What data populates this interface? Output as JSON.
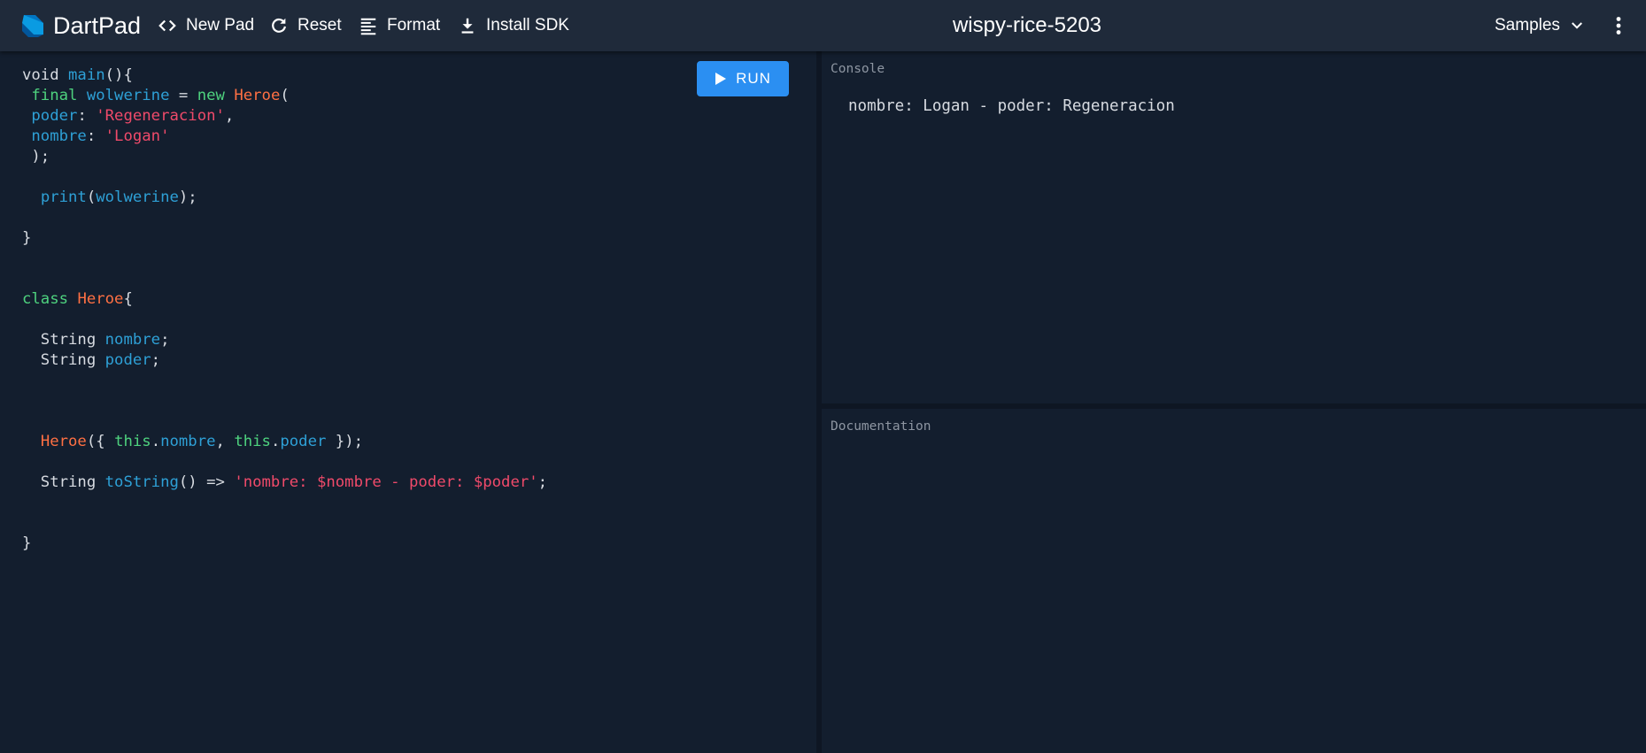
{
  "header": {
    "app_title": "DartPad",
    "toolbar": [
      {
        "id": "new-pad",
        "label": "New Pad",
        "icon": "code-brackets-icon"
      },
      {
        "id": "reset",
        "label": "Reset",
        "icon": "refresh-icon"
      },
      {
        "id": "format",
        "label": "Format",
        "icon": "format-lines-icon"
      },
      {
        "id": "install-sdk",
        "label": "Install SDK",
        "icon": "download-icon"
      }
    ],
    "pad_name": "wispy-rice-5203",
    "samples_label": "Samples",
    "more_icon": "more-vert-icon"
  },
  "editor": {
    "run_label": "RUN",
    "code_lines": [
      "void main(){",
      " final wolwerine = new Heroe(",
      " poder: 'Regeneracion',",
      " nombre: 'Logan'",
      " );",
      "",
      "  print(wolwerine);",
      "",
      "}",
      "",
      "",
      "class Heroe{",
      "",
      "  String nombre;",
      "  String poder;",
      "",
      "",
      "",
      "  Heroe({ this.nombre, this.poder });",
      "",
      "  String toString() => 'nombre: $nombre - poder: $poder';",
      "",
      "",
      "}"
    ]
  },
  "console": {
    "label": "Console",
    "output": "nombre: Logan - poder: Regeneracion"
  },
  "documentation": {
    "label": "Documentation"
  },
  "colors": {
    "background": "#131e2e",
    "header": "#1f2a3a",
    "accent": "#2b8ff2",
    "keyword_green": "#4ed27e",
    "identifier_blue": "#2ea0d6",
    "class_orange": "#ff7043",
    "string_red": "#f04a6a"
  }
}
